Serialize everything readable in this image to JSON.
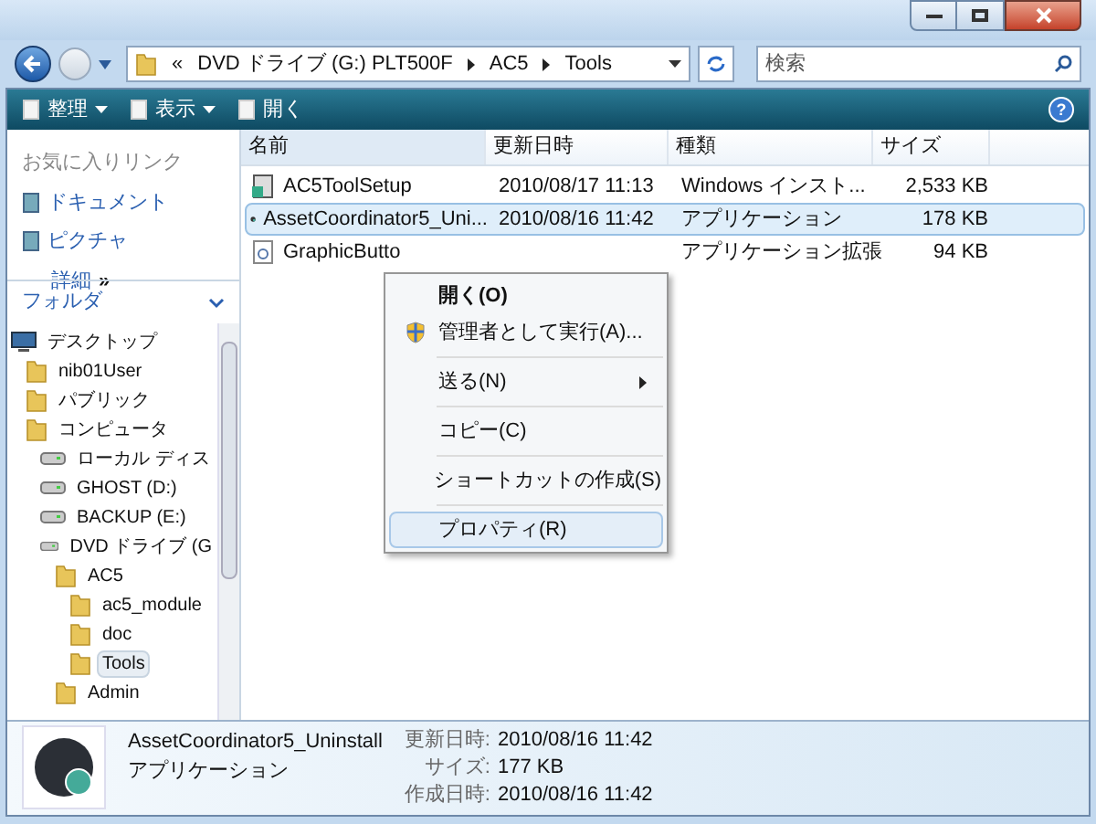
{
  "address": {
    "overflow": "«",
    "crumbs": [
      "DVD ドライブ (G:) PLT500F",
      "AC5",
      "Tools"
    ]
  },
  "search": {
    "placeholder": "検索"
  },
  "toolbar": [
    "整理",
    "表示",
    "開く"
  ],
  "help": "?",
  "favorites": {
    "title": "お気に入りリンク",
    "items": [
      "ドキュメント",
      "ピクチャ"
    ],
    "more": "詳細",
    "more_arrow": "»"
  },
  "folders": {
    "title": "フォルダ",
    "tree": [
      {
        "label": "デスクトップ",
        "selected": false,
        "children": [
          {
            "label": "nib01User",
            "selected": false
          },
          {
            "label": "パブリック",
            "selected": false
          },
          {
            "label": "コンピュータ",
            "selected": false,
            "children": [
              {
                "label": "ローカル ディス",
                "selected": false
              },
              {
                "label": "GHOST (D:)",
                "selected": false
              },
              {
                "label": "BACKUP (E:)",
                "selected": false
              },
              {
                "label": "DVD ドライブ (G",
                "selected": false,
                "children": [
                  {
                    "label": "AC5",
                    "selected": false,
                    "children": [
                      {
                        "label": "ac5_module",
                        "selected": false
                      },
                      {
                        "label": "doc",
                        "selected": false
                      },
                      {
                        "label": "Tools",
                        "selected": true
                      }
                    ]
                  },
                  {
                    "label": "Admin",
                    "selected": false
                  }
                ]
              }
            ]
          }
        ]
      }
    ]
  },
  "table": {
    "columns": [
      "名前",
      "更新日時",
      "種類",
      "サイズ"
    ],
    "rows": [
      {
        "name": "AC5ToolSetup",
        "date": "2010/08/17 11:13",
        "type": "Windows インスト...",
        "size": "2,533 KB",
        "selected": false
      },
      {
        "name": "AssetCoordinator5_Uni...",
        "date": "2010/08/16 11:42",
        "type": "アプリケーション",
        "size": "178 KB",
        "selected": true
      },
      {
        "name": "GraphicButto",
        "date": "",
        "type": "アプリケーション拡張",
        "size": "94 KB",
        "selected": false
      }
    ]
  },
  "context_menu": [
    {
      "kind": "default",
      "label": "開く(O)",
      "selected": false
    },
    {
      "kind": "admin",
      "label": "管理者として実行(A)...",
      "selected": false
    },
    {
      "kind": "separator"
    },
    {
      "kind": "submenu",
      "label": "送る(N)",
      "selected": false
    },
    {
      "kind": "separator"
    },
    {
      "kind": "command",
      "label": "コピー(C)",
      "selected": false
    },
    {
      "kind": "separator"
    },
    {
      "kind": "command",
      "label": "ショートカットの作成(S)",
      "selected": false
    },
    {
      "kind": "separator"
    },
    {
      "kind": "command",
      "label": "プロパティ(R)",
      "selected": true
    }
  ],
  "details": {
    "name": "AssetCoordinator5_Uninstall",
    "type": "アプリケーション",
    "properties": [
      {
        "label": "更新日時:",
        "value": "2010/08/16 11:42"
      },
      {
        "label": "サイズ:",
        "value": "177 KB"
      },
      {
        "label": "作成日時:",
        "value": "2010/08/16 11:42"
      }
    ]
  }
}
